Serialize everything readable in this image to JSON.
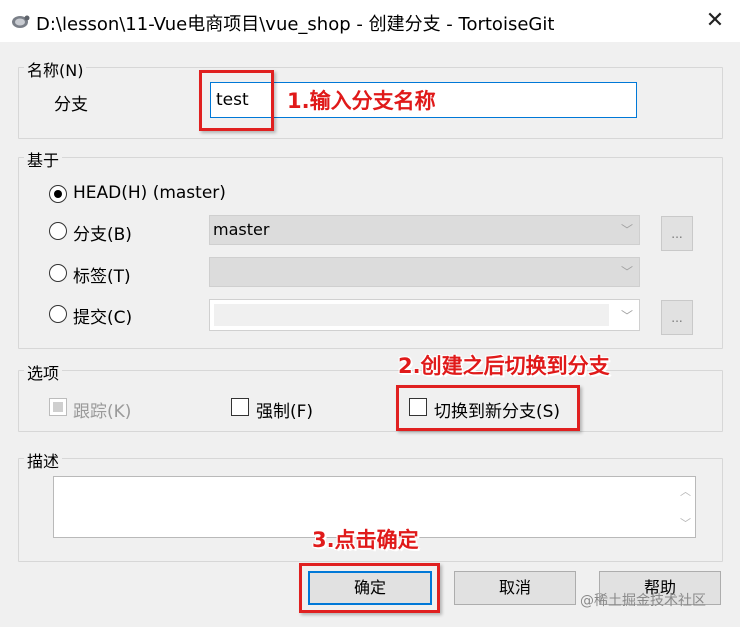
{
  "window": {
    "title": "D:\\lesson\\11-Vue电商项目\\vue_shop - 创建分支 - TortoiseGit",
    "close_glyph": "✕",
    "icon": "tortoise-icon"
  },
  "name_group": {
    "label": "名称(N)",
    "branch_label": "分支",
    "branch_value": "test"
  },
  "base_group": {
    "label": "基于",
    "head_label": "HEAD(H) (master)",
    "branch_label": "分支(B)",
    "branch_value": "master",
    "tag_label": "标签(T)",
    "tag_value": "",
    "commit_label": "提交(C)",
    "commit_value": "",
    "dots": "...",
    "selected": "head"
  },
  "options_group": {
    "label": "选项",
    "track_label": "跟踪(K)",
    "force_label": "强制(F)",
    "switch_label": "切换到新分支(S)"
  },
  "desc_group": {
    "label": "描述",
    "value": ""
  },
  "buttons": {
    "ok": "确定",
    "cancel": "取消",
    "help": "帮助"
  },
  "annotations": {
    "step1": "1.输入分支名称",
    "step2": "2.创建之后切换到分支",
    "step3": "3.点击确定",
    "color": "#e02020"
  },
  "watermark": "@稀土掘金技术社区"
}
